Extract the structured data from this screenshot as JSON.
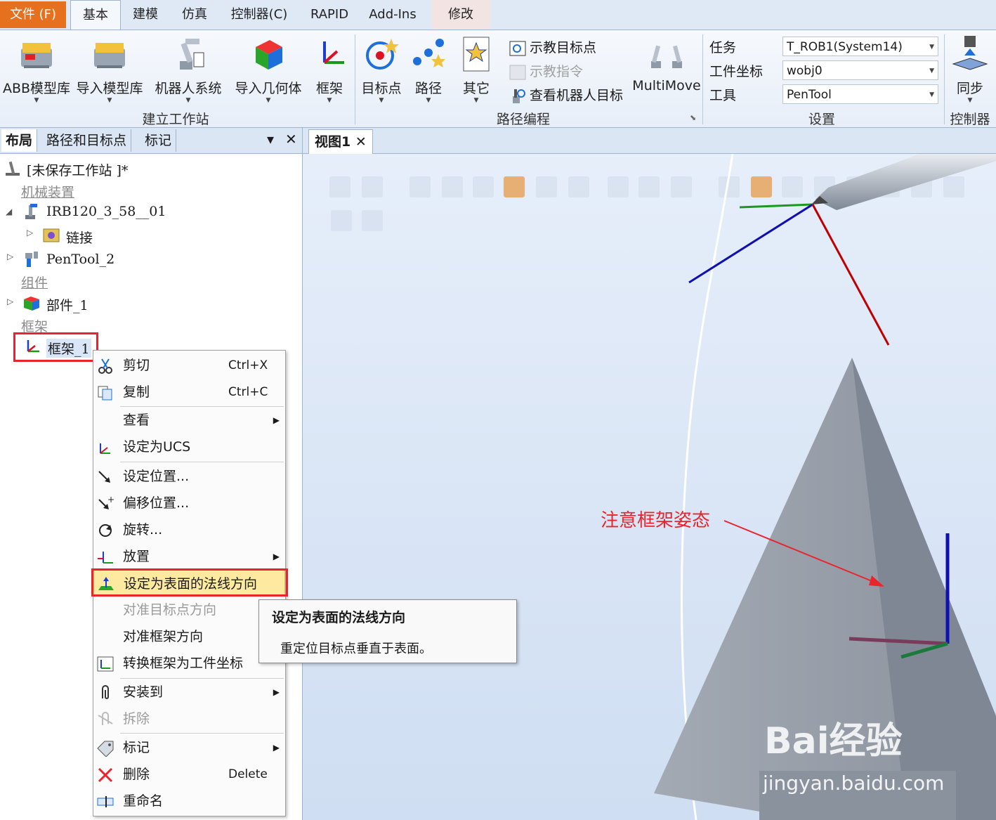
{
  "tabs": {
    "file": "文件 (F)",
    "items": [
      "基本",
      "建模",
      "仿真",
      "控制器(C)",
      "RAPID",
      "Add-Ins",
      "修改"
    ],
    "active": "基本"
  },
  "ribbon": {
    "build_station": {
      "group_label": "建立工作站",
      "buttons": [
        "ABB模型库",
        "导入模型库",
        "机器人系统",
        "导入几何体",
        "框架"
      ]
    },
    "path_programming": {
      "group_label": "路径编程",
      "buttons": [
        "目标点",
        "路径",
        "其它"
      ],
      "small_buttons": [
        {
          "label": "示教目标点",
          "disabled": false
        },
        {
          "label": "示教指令",
          "disabled": true
        },
        {
          "label": "查看机器人目标",
          "disabled": false
        }
      ],
      "multimove": "MultiMove"
    },
    "settings": {
      "group_label": "设置",
      "task_label": "任务",
      "task_value": "T_ROB1(System14)",
      "wobj_label": "工件坐标",
      "wobj_value": "wobj0",
      "tool_label": "工具",
      "tool_value": "PenTool"
    },
    "controller": {
      "group_label": "控制器",
      "sync": "同步"
    }
  },
  "left_panel": {
    "tabs": [
      "布局",
      "路径和目标点",
      "标记"
    ],
    "active_tab": "布局",
    "pin_icon": "▾",
    "close_icon": "✕",
    "tree": {
      "station": "[未保存工作站 ]*",
      "cat_mechanism": "机械装置",
      "robot": "IRB120_3_58__01",
      "links": "链接",
      "tool": "PenTool_2",
      "cat_components": "组件",
      "part": "部件_1",
      "cat_frames": "框架",
      "frame": "框架_1"
    }
  },
  "view": {
    "tab_label": "视图1",
    "close_icon": "✕"
  },
  "context_menu": {
    "cut": {
      "label": "剪切",
      "shortcut": "Ctrl+X"
    },
    "copy": {
      "label": "复制",
      "shortcut": "Ctrl+C"
    },
    "view": "查看",
    "set_ucs": "设定为UCS",
    "set_position": "设定位置...",
    "offset_position": "偏移位置...",
    "rotate": "旋转...",
    "place": "放置",
    "set_normal": "设定为表面的法线方向",
    "align_target": "对准目标点方向",
    "align_frame": "对准框架方向",
    "convert_wobj": "转换框架为工件坐标",
    "attach": "安装到",
    "detach": "拆除",
    "mark": "标记",
    "delete": {
      "label": "删除",
      "shortcut": "Delete"
    },
    "rename": "重命名"
  },
  "tooltip": {
    "title": "设定为表面的法线方向",
    "description": "重定位目标点垂直于表面。"
  },
  "annotation": "注意框架姿态",
  "watermark": {
    "logo": "Bai经验",
    "url": "jingyan.baidu.com"
  },
  "colors": {
    "file_tab": "#e6701e",
    "highlight": "#e8252d",
    "menu_hover": "#fdeaa0",
    "axis_x": "#c00000",
    "axis_y": "#1a9a1a",
    "axis_z": "#1010b0"
  }
}
